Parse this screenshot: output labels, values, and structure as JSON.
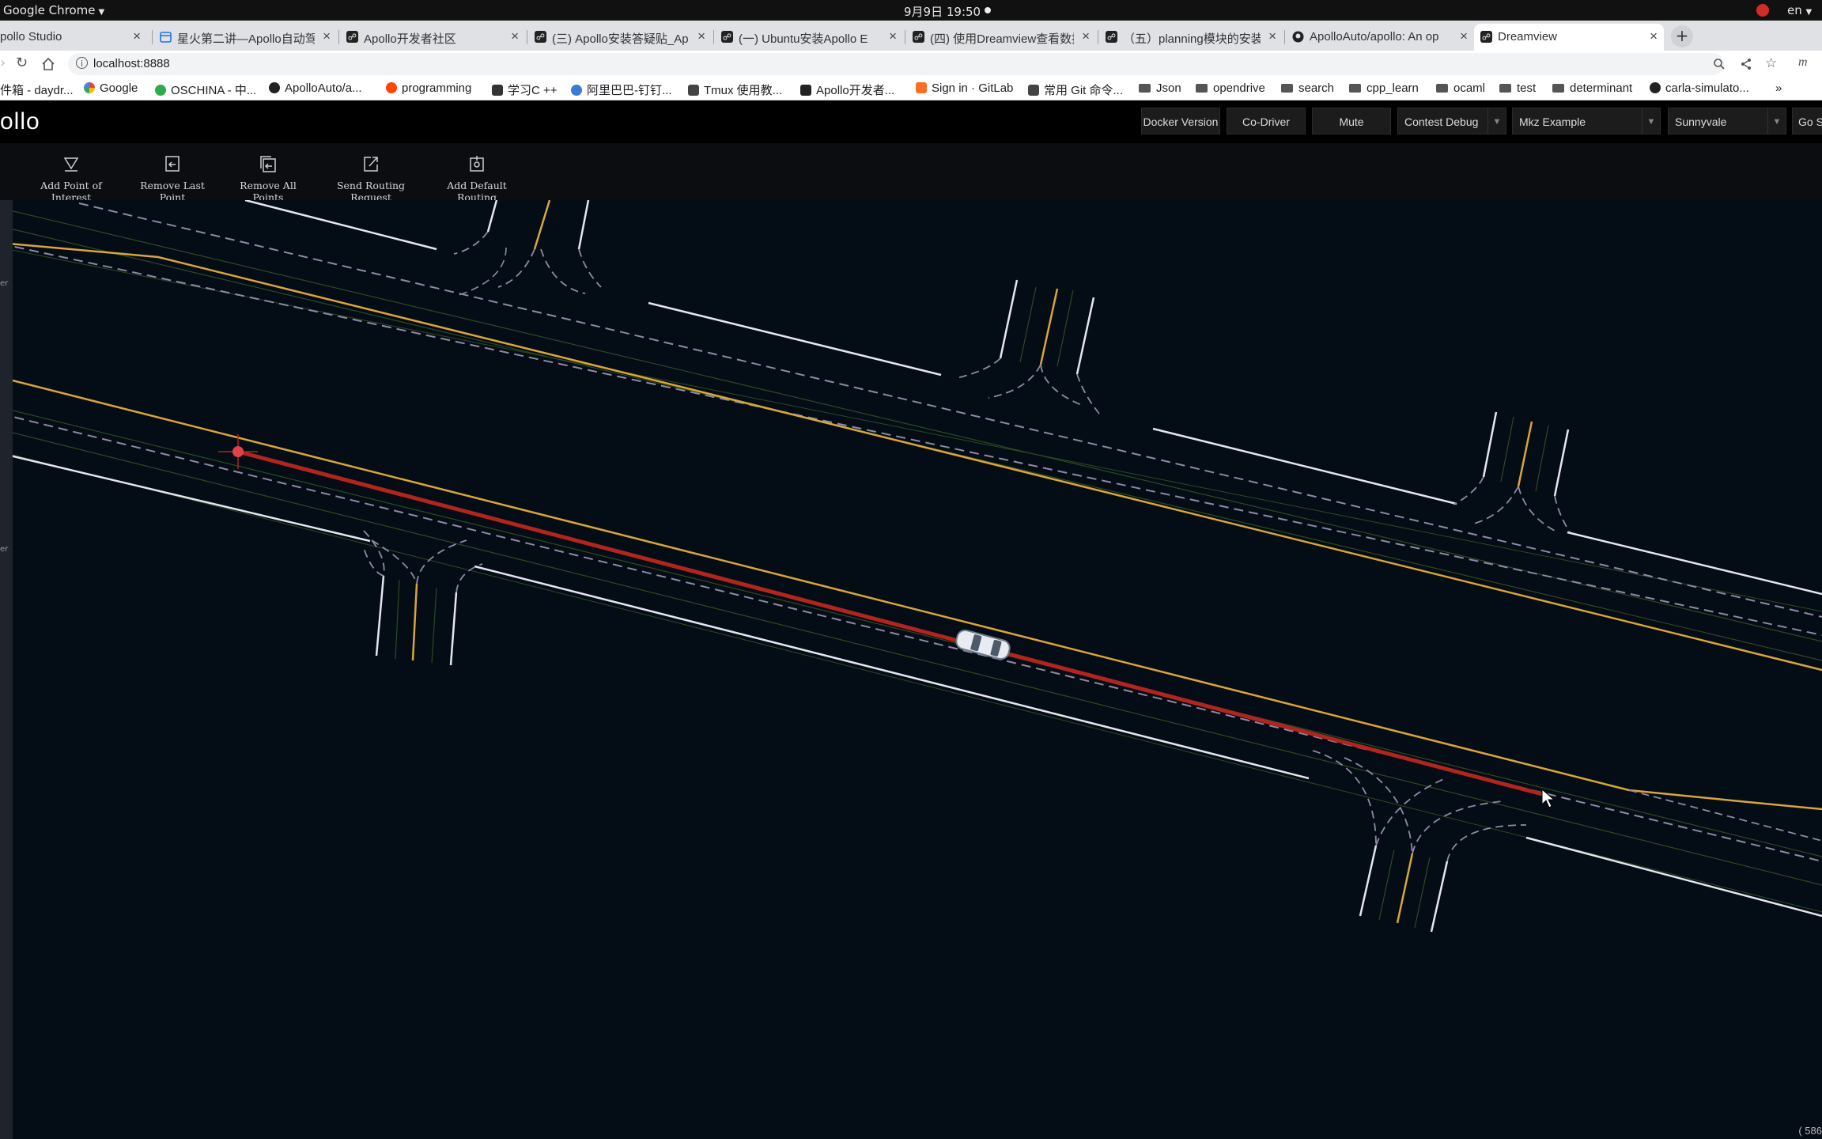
{
  "os": {
    "app_name": "Google Chrome",
    "datetime": "9月9日  19:50",
    "language": "en"
  },
  "tabs": [
    {
      "title": "pollo Studio",
      "active": false
    },
    {
      "title": "星火第二讲—Apollo自动驾驶",
      "active": false
    },
    {
      "title": "Apollo开发者社区",
      "active": false
    },
    {
      "title": "(三) Apollo安装答疑贴_Ap",
      "active": false
    },
    {
      "title": "(一) Ubuntu安装Apollo E",
      "active": false
    },
    {
      "title": "(四) 使用Dreamview查看数据",
      "active": false
    },
    {
      "title": "（五）planning模块的安装",
      "active": false
    },
    {
      "title": "ApolloAuto/apollo: An op",
      "active": false
    },
    {
      "title": "Dreamview",
      "active": true
    }
  ],
  "address_bar": {
    "url": "localhost:8888"
  },
  "bookmarks": [
    "件箱 - daydr...",
    "Google",
    "OSCHINA - 中...",
    "ApolloAuto/a...",
    "programming",
    "学习C ++",
    "阿里巴巴-钉钉...",
    "Tmux 使用教...",
    "Apollo开发者...",
    "Sign in · GitLab",
    "常用 Git 命令...",
    "Json",
    "opendrive",
    "search",
    "cpp_learn",
    "ocaml",
    "test",
    "determinant",
    "carla-simulato..."
  ],
  "bookmarks_overflow": "»",
  "dreamview": {
    "logo": "ollo",
    "header_buttons": [
      "Docker Version",
      "Co-Driver",
      "Mute"
    ],
    "selects": {
      "mode": "Contest Debug",
      "vehicle": "Mkz Example",
      "map": "Sunnyvale",
      "go": "Go S"
    },
    "routing_tools": [
      {
        "label": "Add Point of Interest",
        "icon": "poi-icon"
      },
      {
        "label": "Remove Last Point",
        "icon": "undo-point-icon"
      },
      {
        "label": "Remove All Points",
        "icon": "remove-all-icon"
      },
      {
        "label": "Send Routing Request",
        "icon": "send-icon"
      },
      {
        "label": "Add Default Routing",
        "icon": "default-routing-icon"
      }
    ],
    "left_strip_labels": [
      "er",
      "er"
    ],
    "coordinates": "( 586"
  },
  "colors": {
    "map_bg": "#040c16",
    "lane_yellow": "#d9a637",
    "lane_white": "#e6e6ee",
    "route_red": "#b1251d",
    "lane_dashed": "#8f8aa6",
    "lane_center_green": "#2d4a22"
  }
}
